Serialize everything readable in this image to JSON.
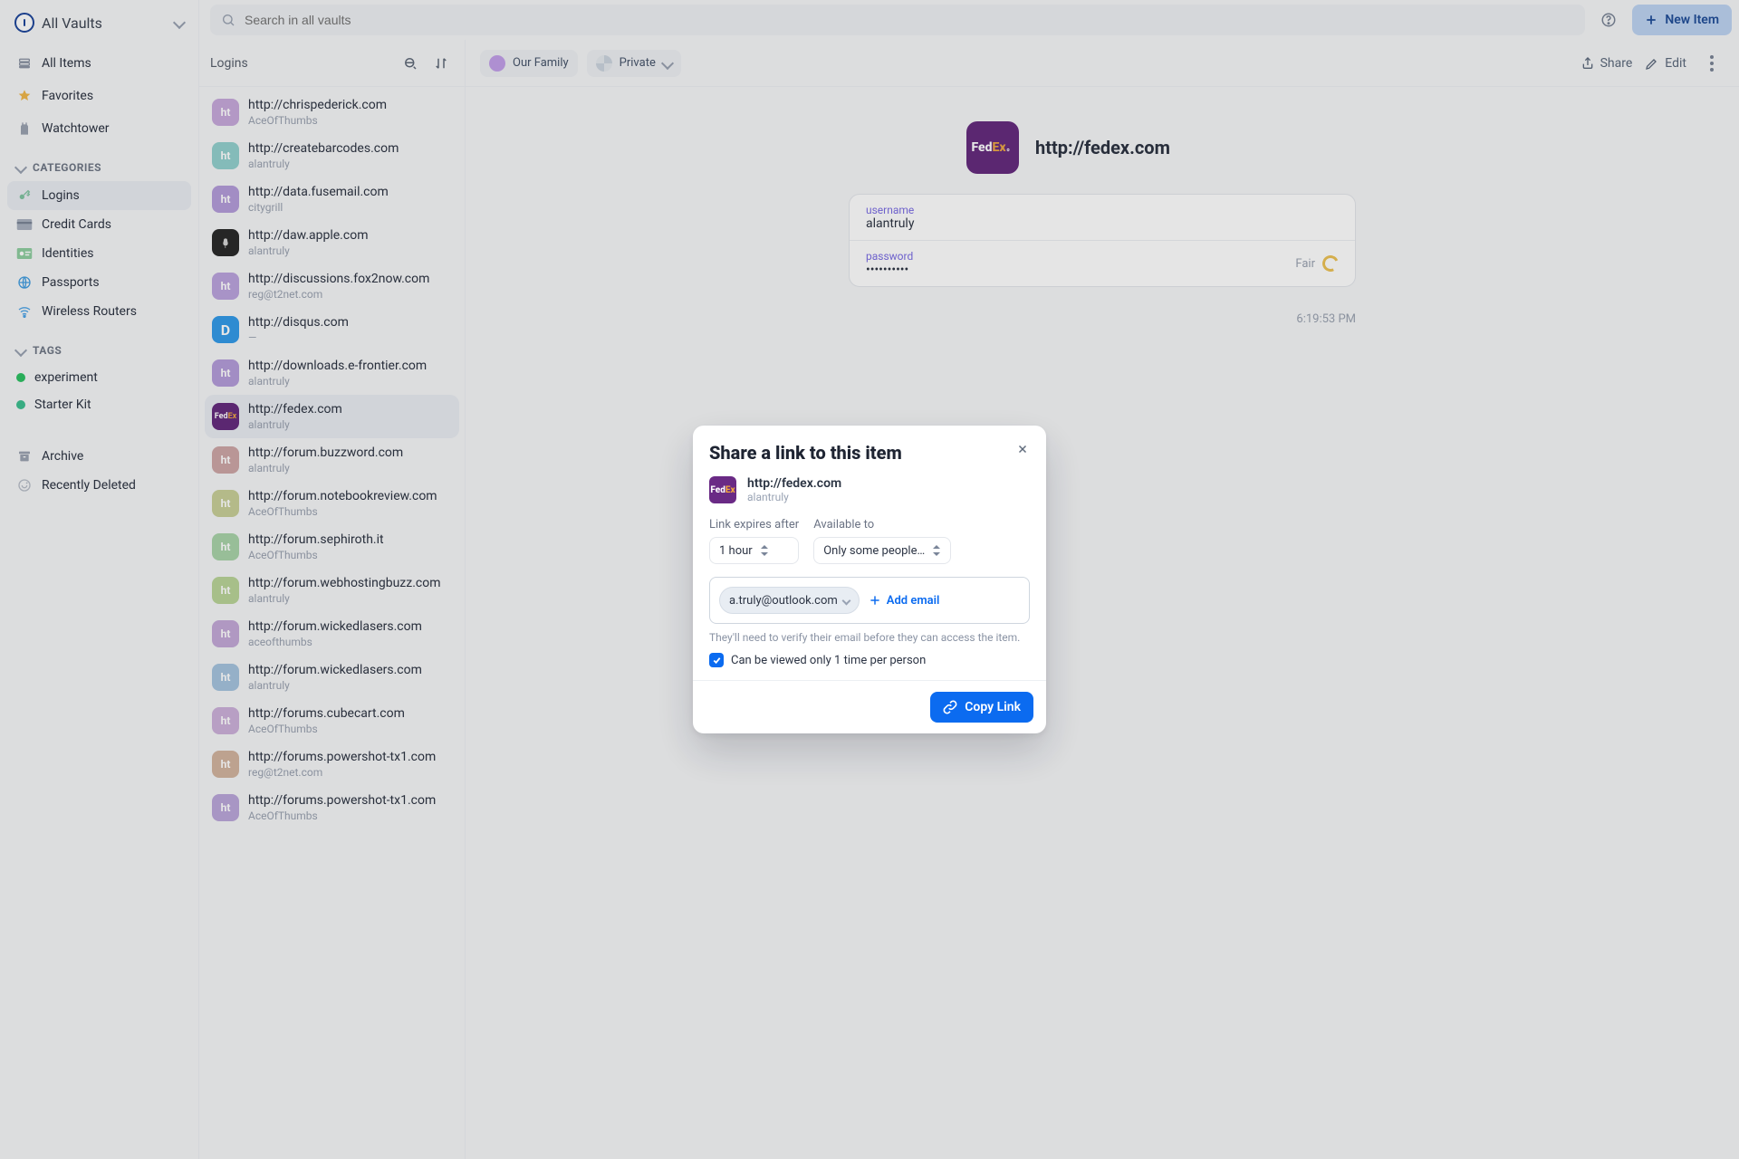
{
  "header": {
    "vault_selector": "All Vaults",
    "search_placeholder": "Search in all vaults",
    "new_item": "New Item"
  },
  "sidebar": {
    "items": [
      {
        "label": "All Items",
        "icon": "stack-icon"
      },
      {
        "label": "Favorites",
        "icon": "star-icon"
      },
      {
        "label": "Watchtower",
        "icon": "tower-icon"
      }
    ],
    "categories_header": "CATEGORIES",
    "categories": [
      {
        "label": "Logins",
        "icon": "key-icon",
        "active": true
      },
      {
        "label": "Credit Cards",
        "icon": "card-icon"
      },
      {
        "label": "Identities",
        "icon": "id-icon"
      },
      {
        "label": "Passports",
        "icon": "globe-icon"
      },
      {
        "label": "Wireless Routers",
        "icon": "wifi-icon"
      }
    ],
    "tags_header": "TAGS",
    "tags": [
      {
        "label": "experiment",
        "color": "#22c55e"
      },
      {
        "label": "Starter Kit",
        "color": "#34c38f"
      }
    ],
    "footer": [
      {
        "label": "Archive",
        "icon": "archive-icon"
      },
      {
        "label": "Recently Deleted",
        "icon": "trash-icon"
      }
    ]
  },
  "list": {
    "header": "Logins",
    "items": [
      {
        "title": "http://chrispederick.com",
        "sub": "AceOfThumbs",
        "bg": "#caa9e0",
        "txt": "ht"
      },
      {
        "title": "http://createbarcodes.com",
        "sub": "alantruly",
        "bg": "#8fd2cf",
        "txt": "ht"
      },
      {
        "title": "http://data.fusemail.com",
        "sub": "citygrill",
        "bg": "#b79de1",
        "txt": "ht"
      },
      {
        "title": "http://daw.apple.com",
        "sub": "alantruly",
        "bg": "#2b2b2b",
        "txt": ""
      },
      {
        "title": "http://discussions.fox2now.com",
        "sub": "reg@t2net.com",
        "bg": "#bea3e3",
        "txt": "ht"
      },
      {
        "title": "http://disqus.com",
        "sub": "—",
        "bg": "#2a9df4",
        "txt": "D"
      },
      {
        "title": "http://downloads.e-frontier.com",
        "sub": "alantruly",
        "bg": "#b79de1",
        "txt": "ht"
      },
      {
        "title": "http://fedex.com",
        "sub": "alantruly",
        "bg": "#6a2a85",
        "txt": "FedEx",
        "selected": true
      },
      {
        "title": "http://forum.buzzword.com",
        "sub": "alantruly",
        "bg": "#d1a6a6",
        "txt": "ht"
      },
      {
        "title": "http://forum.notebookreview.com",
        "sub": "AceOfThumbs",
        "bg": "#c9d193",
        "txt": "ht"
      },
      {
        "title": "http://forum.sephiroth.it",
        "sub": "AceOfThumbs",
        "bg": "#a7d5a7",
        "txt": "ht"
      },
      {
        "title": "http://forum.webhostingbuzz.com",
        "sub": "alantruly",
        "bg": "#b8d693",
        "txt": "ht"
      },
      {
        "title": "http://forum.wickedlasers.com",
        "sub": "aceofthumbs",
        "bg": "#c6a9dd",
        "txt": "ht"
      },
      {
        "title": "http://forum.wickedlasers.com",
        "sub": "alantruly",
        "bg": "#a3c5e3",
        "txt": "ht"
      },
      {
        "title": "http://forums.cubecart.com",
        "sub": "AceOfThumbs",
        "bg": "#cfb0df",
        "txt": "ht"
      },
      {
        "title": "http://forums.powershot-tx1.com",
        "sub": "reg@t2net.com",
        "bg": "#d6b49d",
        "txt": "ht"
      },
      {
        "title": "http://forums.powershot-tx1.com",
        "sub": "AceOfThumbs",
        "bg": "#bda6e0",
        "txt": "ht"
      }
    ]
  },
  "detail": {
    "family_label": "Our Family",
    "private_label": "Private",
    "share": "Share",
    "edit": "Edit",
    "item_title": "http://fedex.com",
    "fields": {
      "username_label": "username",
      "username_value": "alantruly",
      "password_label": "password",
      "password_value": "••••••••••",
      "password_strength": "Fair"
    },
    "timestamp": "6:19:53 PM"
  },
  "dialog": {
    "title": "Share a link to this item",
    "item_title": "http://fedex.com",
    "item_sub": "alantruly",
    "expires_label": "Link expires after",
    "expires_value": "1 hour",
    "available_label": "Available to",
    "available_value": "Only some people…",
    "email_chip": "a.truly@outlook.com",
    "add_email": "Add email",
    "hint": "They'll need to verify their email before they can access the item.",
    "view_once": "Can be viewed only 1 time per person",
    "copy_link": "Copy Link"
  }
}
